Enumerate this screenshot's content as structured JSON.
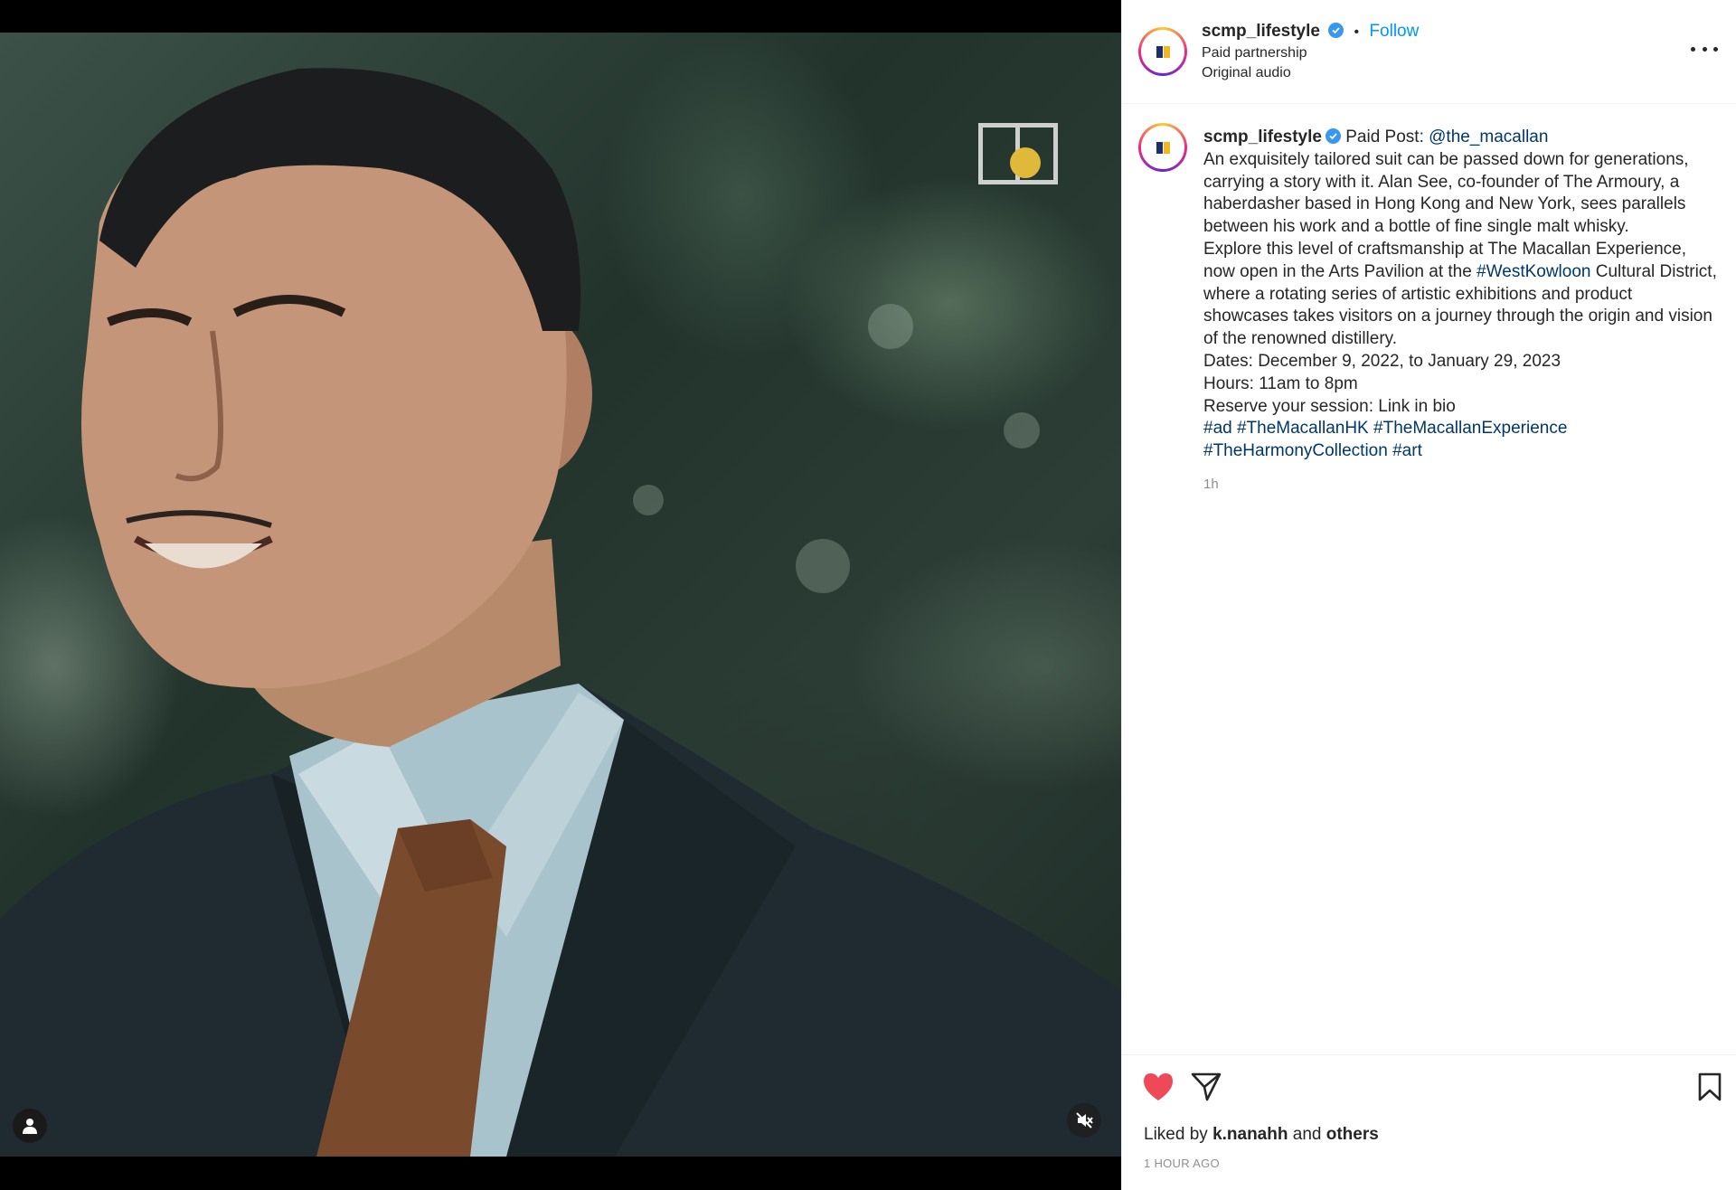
{
  "account": {
    "username": "scmp_lifestyle",
    "separator": "•",
    "follow_label": "Follow",
    "partnership_label": "Paid partnership",
    "audio_label": "Original audio"
  },
  "caption": {
    "username": "scmp_lifestyle",
    "paid_post_prefix": "Paid Post:",
    "paid_post_mention": "@the_macallan",
    "paragraph1": "An exquisitely tailored suit can be passed down for generations, carrying a story with it. Alan See, co-founder of The Armoury, a haberdasher based in Hong Kong and New York, sees parallels between his work and a bottle of fine single malt whisky.",
    "paragraph2_before": "Explore this level of craftsmanship at The Macallan Experience, now open in the Arts Pavilion at the",
    "paragraph2_tag": "#WestKowloon",
    "paragraph2_after": "Cultural District, where a rotating series of artistic exhibitions and product showcases takes visitors on a journey through the origin and vision of the renowned distillery.",
    "dates": "Dates: December 9, 2022, to January 29, 2023",
    "hours": "Hours: 11am to 8pm",
    "reserve": "Reserve your session: Link in bio",
    "hashtags": [
      "#ad",
      "#TheMacallanHK",
      "#TheMacallanExperience",
      "#TheHarmonyCollection",
      "#art"
    ],
    "age": "1h"
  },
  "engagement": {
    "liked_by_prefix": "Liked by",
    "liked_by_user": "k.nanahh",
    "and_label": "and",
    "others_label": "others",
    "posted": "1 HOUR AGO"
  },
  "icons": {
    "like": "heart-icon",
    "share": "send-icon",
    "save": "bookmark-icon",
    "tags": "user-icon",
    "mute": "speaker-muted-icon",
    "more": "more-options-icon"
  },
  "colors": {
    "like_red": "#ed4956",
    "link_blue": "#0095f6",
    "hashtag_navy": "#00376b",
    "verified_blue": "#3897f0",
    "avatar_navy": "#1c2f6b",
    "avatar_gold": "#f2b61e"
  }
}
